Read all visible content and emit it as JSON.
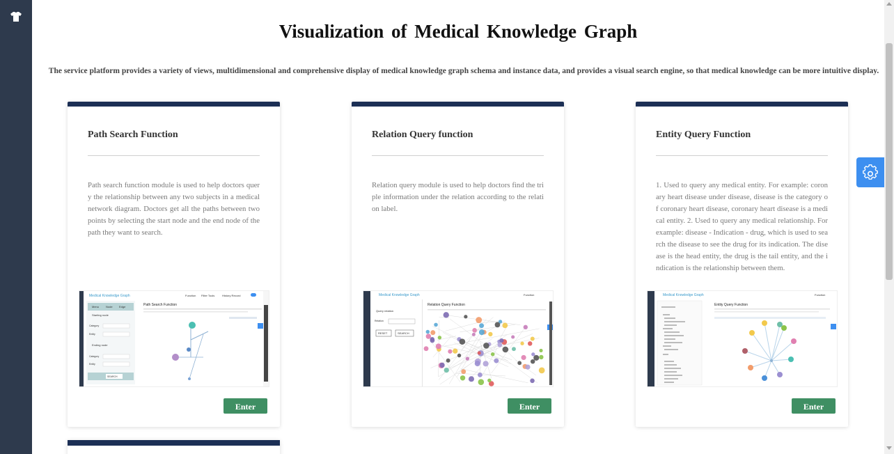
{
  "page": {
    "title": "Visualization of Medical Knowledge Graph",
    "subtitle": "The service platform provides a variety of views, multidimensional and comprehensive display of medical knowledge graph schema and instance data, and provides a visual search engine, so that medical knowledge can be more intuitive display."
  },
  "cards": [
    {
      "title": "Path Search Function",
      "description": "Path search function module is used to help doctors query the relationship between any two subjects in a medical network diagram. Doctors get all the paths between two points by selecting the start node and the end node of the path they want to search.",
      "button": "Enter",
      "preview": {
        "app_title": "Medical Knowledge Graph",
        "nav": [
          "Function",
          "Filter Tools",
          "History Record"
        ],
        "panel_title": "Path Search Function",
        "tabs": [
          "Menu",
          "Node",
          "Edge"
        ],
        "start_label": "Starting node",
        "end_label": "Ending node",
        "field_category": "Category",
        "field_entity": "Entity",
        "action": "SEARCH"
      }
    },
    {
      "title": "Relation Query function",
      "description": "Relation query module is used to help doctors find the triple information under the relation according to the relation label.",
      "button": "Enter",
      "preview": {
        "app_title": "Medical Knowledge Graph",
        "nav": [
          "Function"
        ],
        "panel_title": "Relation Query Function",
        "side_title": "Query relation",
        "field_relation": "Relation",
        "reset": "RESET",
        "action": "SEARCH"
      }
    },
    {
      "title": "Entity Query Function",
      "description": "1. Used to query any medical entity. For example: coronary heart disease under disease, disease is the category of coronary heart disease, coronary heart disease is a medical entity. 2. Used to query any medical relationship. For example: disease - Indication - drug, which is used to search the disease to see the drug for its indication. The disease is the head entity, the drug is the tail entity, and the indication is the relationship between them.",
      "button": "Enter",
      "preview": {
        "app_title": "Medical Knowledge Graph",
        "nav": [
          "Function"
        ],
        "panel_title": "Entity Query Function"
      }
    }
  ],
  "icons": {
    "sidebar_logo": "shirt-icon",
    "settings": "gear-icon"
  },
  "colors": {
    "sidebar": "#2e3a4d",
    "card_bar": "#1c2f55",
    "button": "#3f8f63",
    "settings": "#3d8ff0"
  }
}
